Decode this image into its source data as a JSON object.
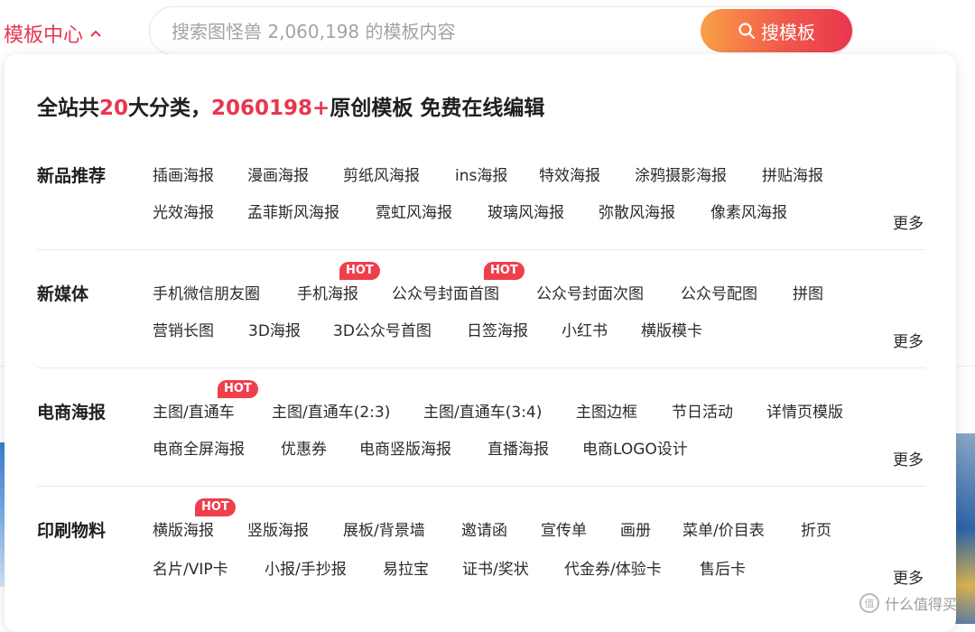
{
  "nav": {
    "menu_label": "模板中心",
    "search_placeholder": "搜索图怪兽 2,060,198 的模板内容",
    "search_button": "搜模板"
  },
  "panel": {
    "headline": {
      "prefix": "全站共",
      "category_count": "20",
      "middle": "大分类，",
      "template_count": "2060198+",
      "suffix": "原创模板 免费在线编辑"
    },
    "more_label": "更多",
    "hot_label": "HOT",
    "categories": [
      {
        "title": "新品推荐",
        "row1": [
          "插画海报",
          "漫画海报",
          "剪纸风海报",
          "ins海报",
          "特效海报",
          "涂鸦摄影海报",
          "拼贴海报"
        ],
        "row2": [
          "光效海报",
          "孟菲斯风海报",
          "霓虹风海报",
          "玻璃风海报",
          "弥散风海报",
          "像素风海报"
        ]
      },
      {
        "title": "新媒体",
        "row1": [
          "手机微信朋友圈",
          "手机海报",
          "公众号封面首图",
          "公众号封面次图",
          "公众号配图",
          "拼图"
        ],
        "row2": [
          "营销长图",
          "3D海报",
          "3D公众号首图",
          "日签海报",
          "小红书",
          "横版模卡"
        ]
      },
      {
        "title": "电商海报",
        "row1": [
          "主图/直通车",
          "主图/直通车(2:3)",
          "主图/直通车(3:4)",
          "主图边框",
          "节日活动",
          "详情页模版"
        ],
        "row2": [
          "电商全屏海报",
          "优惠券",
          "电商竖版海报",
          "直播海报",
          "电商LOGO设计"
        ]
      },
      {
        "title": "印刷物料",
        "row1": [
          "横版海报",
          "竖版海报",
          "展板/背景墙",
          "邀请函",
          "宣传单",
          "画册",
          "菜单/价目表",
          "折页"
        ],
        "row2": [
          "名片/VIP卡",
          "小报/手抄报",
          "易拉宝",
          "证书/奖状",
          "代金券/体验卡",
          "售后卡"
        ]
      }
    ]
  },
  "watermark": "什么值得买",
  "colors": {
    "accent": "#e8364f",
    "hot_badge": "#ef3f4c",
    "button_start": "#f9a046",
    "button_end": "#e8364f"
  }
}
